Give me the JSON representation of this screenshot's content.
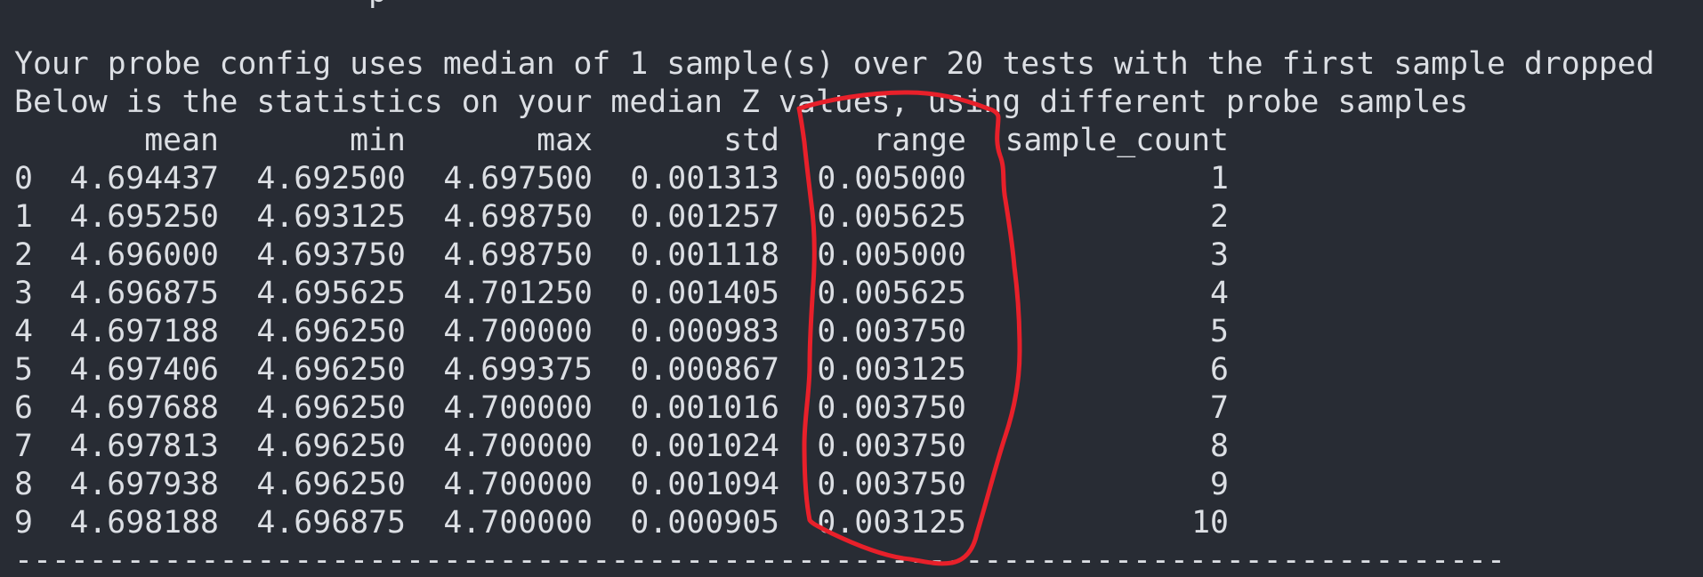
{
  "terminal": {
    "partial_top_line": "                   p",
    "info_line_1": "Your probe config uses median of 1 sample(s) over 20 tests with the first sample dropped",
    "info_line_2": "Below is the statistics on your median Z values, using different probe samples",
    "separator": "-------------------------------------------------------------------------------------------",
    "columns": [
      "mean",
      "min",
      "max",
      "std",
      "range",
      "sample_count"
    ],
    "rows": [
      {
        "idx": "0",
        "mean": "4.694437",
        "min": "4.692500",
        "max": "4.697500",
        "std": "0.001313",
        "range": "0.005000",
        "sample_count": "1"
      },
      {
        "idx": "1",
        "mean": "4.695250",
        "min": "4.693125",
        "max": "4.698750",
        "std": "0.001257",
        "range": "0.005625",
        "sample_count": "2"
      },
      {
        "idx": "2",
        "mean": "4.696000",
        "min": "4.693750",
        "max": "4.698750",
        "std": "0.001118",
        "range": "0.005000",
        "sample_count": "3"
      },
      {
        "idx": "3",
        "mean": "4.696875",
        "min": "4.695625",
        "max": "4.701250",
        "std": "0.001405",
        "range": "0.005625",
        "sample_count": "4"
      },
      {
        "idx": "4",
        "mean": "4.697188",
        "min": "4.696250",
        "max": "4.700000",
        "std": "0.000983",
        "range": "0.003750",
        "sample_count": "5"
      },
      {
        "idx": "5",
        "mean": "4.697406",
        "min": "4.696250",
        "max": "4.699375",
        "std": "0.000867",
        "range": "0.003125",
        "sample_count": "6"
      },
      {
        "idx": "6",
        "mean": "4.697688",
        "min": "4.696250",
        "max": "4.700000",
        "std": "0.001016",
        "range": "0.003750",
        "sample_count": "7"
      },
      {
        "idx": "7",
        "mean": "4.697813",
        "min": "4.696250",
        "max": "4.700000",
        "std": "0.001024",
        "range": "0.003750",
        "sample_count": "8"
      },
      {
        "idx": "8",
        "mean": "4.697938",
        "min": "4.696250",
        "max": "4.700000",
        "std": "0.001094",
        "range": "0.003750",
        "sample_count": "9"
      },
      {
        "idx": "9",
        "mean": "4.698188",
        "min": "4.696875",
        "max": "4.700000",
        "std": "0.000905",
        "range": "0.003125",
        "sample_count": "10"
      }
    ]
  },
  "colors": {
    "background": "#282c34",
    "text": "#dcdfe4",
    "annotation": "#e8202a"
  },
  "annotation": {
    "shape": "hand-drawn-loop",
    "highlights_column": "range"
  }
}
